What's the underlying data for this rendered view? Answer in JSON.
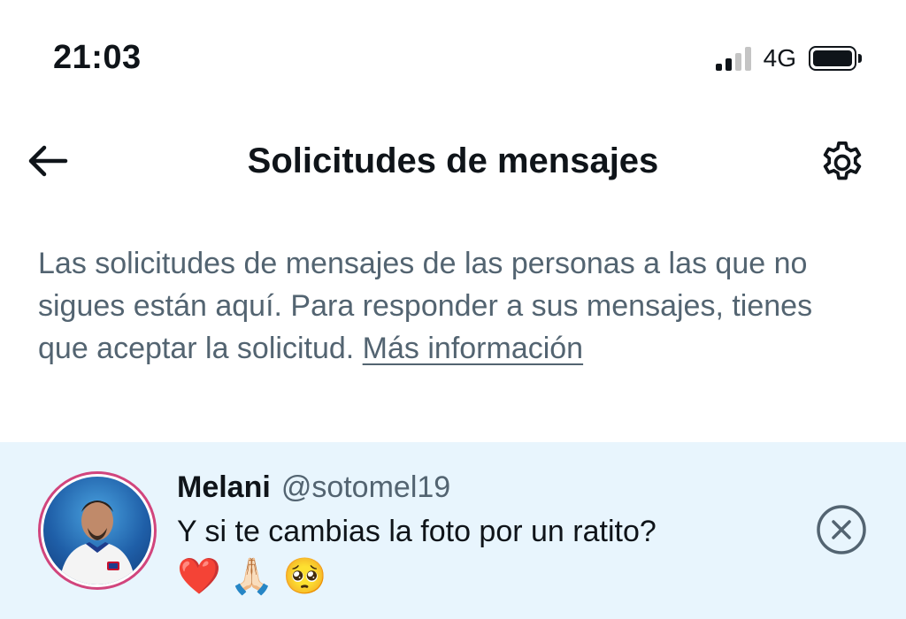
{
  "status_bar": {
    "time": "21:03",
    "network": "4G",
    "signal_bars_filled": 2,
    "signal_bars_total": 4,
    "battery_level": 1.0
  },
  "header": {
    "title": "Solicitudes de mensajes",
    "back_icon": "arrow-left-icon",
    "settings_icon": "gear-icon"
  },
  "description": {
    "text": "Las solicitudes de mensajes de las personas a las que no sigues están aquí. Para responder a sus mensajes, tienes que aceptar la solicitud. ",
    "link_text": "Más información"
  },
  "requests": [
    {
      "name": "Melani",
      "handle": "@sotomel19",
      "message": "Y si te cambias la foto por un ratito?",
      "emojis": [
        "❤️",
        "🙏🏻",
        "🥺"
      ],
      "dismiss_icon": "close-circle-icon"
    }
  ],
  "colors": {
    "row_highlight": "#e8f5fd",
    "secondary_text": "#536471",
    "primary_text": "#0f1419",
    "avatar_ring": "#d1457d"
  }
}
